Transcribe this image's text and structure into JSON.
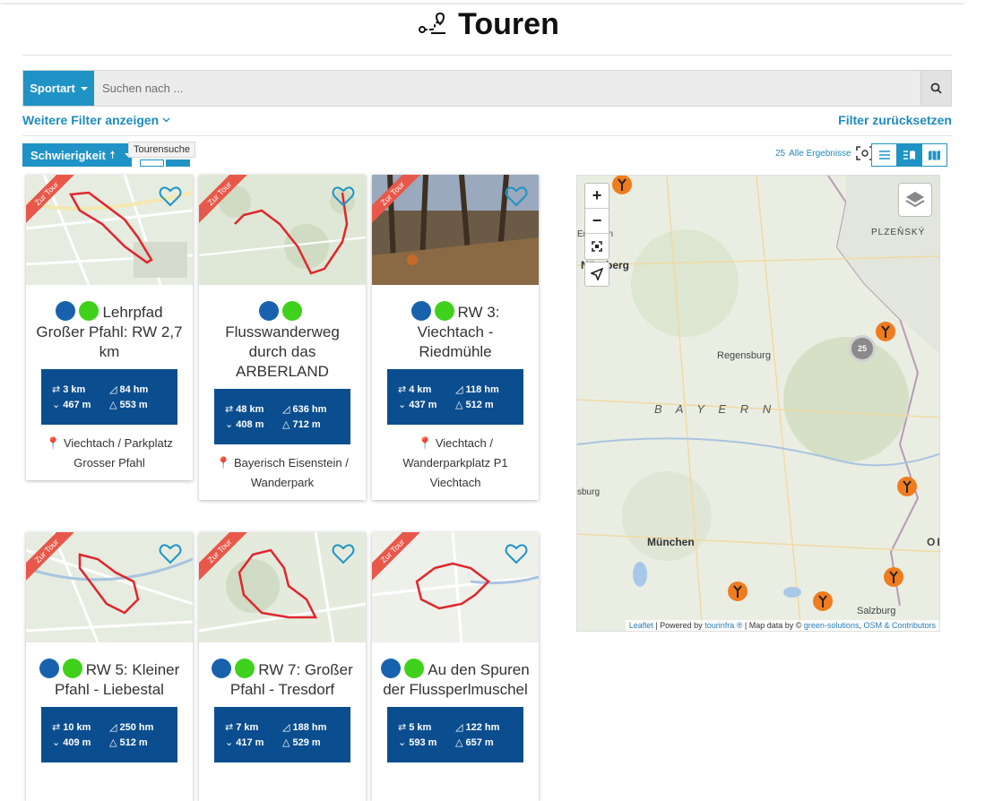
{
  "page": {
    "title": "Touren"
  },
  "search": {
    "sport_label": "Sportart",
    "placeholder": "Suchen nach ..."
  },
  "filters": {
    "more_label": "Weitere Filter anzeigen",
    "reset_label": "Filter zurücksetzen"
  },
  "toolbar": {
    "sort_label": "Schwierigkeit",
    "tooltip": "Tourensuche",
    "results_count": "25",
    "results_label": "Alle Ergebnisse"
  },
  "colors": {
    "accent": "#1f93c6",
    "stats_bg": "#0b4e8f",
    "difficulty_easy": "#3fd11c",
    "ribbon": "#e8584a",
    "route": "#e0262d"
  },
  "cards": [
    {
      "ribbon": "Zur Tour",
      "title": "Lehrpfad Großer Pfahl: RW 2,7 km",
      "distance": "3 km",
      "ascent_hm": "84 hm",
      "min_alt": "467 m",
      "max_alt": "553 m",
      "location": "Viechtach / Parkplatz Grosser Pfahl"
    },
    {
      "ribbon": "Zur Tour",
      "title": "Flusswanderweg durch das ARBERLAND",
      "distance": "48 km",
      "ascent_hm": "636 hm",
      "min_alt": "408 m",
      "max_alt": "712 m",
      "location": "Bayerisch Eisenstein / Wanderpark"
    },
    {
      "ribbon": "Zur Tour",
      "title": "RW 3: Viechtach - Riedmühle",
      "distance": "4 km",
      "ascent_hm": "118 hm",
      "min_alt": "437 m",
      "max_alt": "512 m",
      "location": "Viechtach / Wanderparkplatz P1 Viechtach"
    },
    {
      "ribbon": "Zur Tour",
      "title": "RW 5: Kleiner Pfahl - Liebestal",
      "distance": "10 km",
      "ascent_hm": "250 hm",
      "min_alt": "409 m",
      "max_alt": "512 m"
    },
    {
      "ribbon": "Zur Tour",
      "title": "RW 7: Großer Pfahl - Tresdorf",
      "distance": "7 km",
      "ascent_hm": "188 hm",
      "min_alt": "417 m",
      "max_alt": "529 m"
    },
    {
      "ribbon": "Zur Tour",
      "title": "Au den Spuren der Flussperlmuschel",
      "distance": "5 km",
      "ascent_hm": "122 hm",
      "min_alt": "593 m",
      "max_alt": "657 m"
    }
  ],
  "map": {
    "labels": {
      "plzen": "PLZEŇSKÝ",
      "nberg": "Nürnberg",
      "erlangen": "Erlangen",
      "regensburg": "Regensburg",
      "bayern": "B A Y E R N",
      "burg": "sburg",
      "munchen": "München",
      "salzburg": "Salzburg",
      "ob": "OB"
    },
    "cluster_count": "25",
    "attribution": {
      "leaflet": "Leaflet",
      "powered": "| Powered by",
      "tourinfra": "tourinfra ®",
      "mapdata": "| Map data by ©",
      "green": "green-solutions",
      "osm": "OSM & Contributors"
    }
  }
}
